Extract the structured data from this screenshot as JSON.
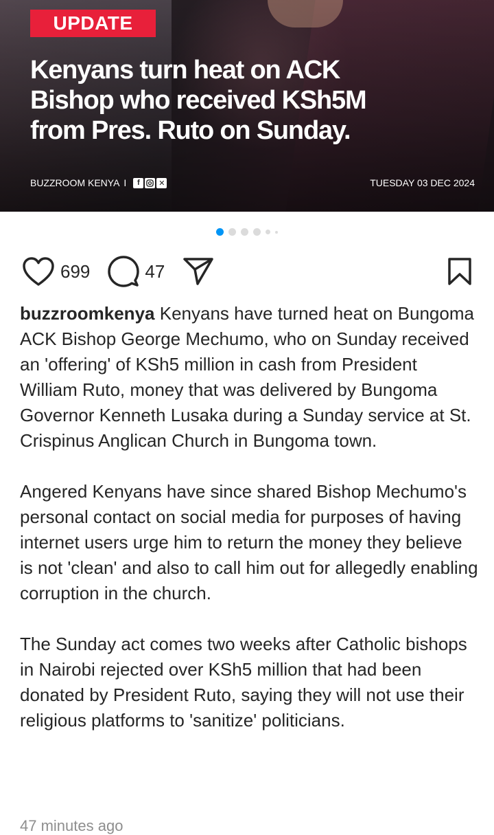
{
  "post_image": {
    "badge": "UPDATE",
    "headline": "Kenyans turn heat on ACK Bishop who received KSh5M from Pres. Ruto on Sunday.",
    "brand": "BUZZROOM KENYA",
    "separator": "I",
    "social_icons": [
      "facebook-icon",
      "instagram-icon",
      "x-icon"
    ],
    "date": "TUESDAY 03 DEC 2024"
  },
  "carousel": {
    "total": 6,
    "active_index": 1
  },
  "actions": {
    "likes": "699",
    "comments": "47"
  },
  "caption": {
    "username": "buzzroomkenya",
    "paragraph1": "Kenyans have turned heat on Bungoma ACK Bishop George Mechumo, who on Sunday received an 'offering' of KSh5 million in cash from President William Ruto, money that was delivered by Bungoma Governor Kenneth Lusaka during a Sunday service at St. Crispinus Anglican Church in Bungoma town.",
    "paragraph2": "Angered Kenyans have since shared Bishop Mechumo's personal contact on social media for purposes of having internet users urge him to return the money they believe is not 'clean' and also to call him out for allegedly enabling corruption in the church.",
    "paragraph3": "The Sunday act comes two weeks after Catholic bishops in Nairobi rejected over KSh5 million that had been donated by President Ruto, saying they will not use their religious platforms to 'sanitize' politicians."
  },
  "timestamp": "47 minutes ago",
  "colors": {
    "badge": "#e8203a",
    "active_dot": "#0095f6",
    "muted": "#8e8e8e"
  }
}
